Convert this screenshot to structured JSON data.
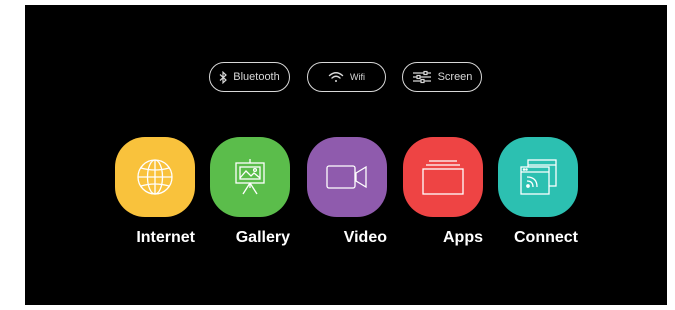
{
  "quick_settings": [
    {
      "label": "Bluetooth",
      "icon": "bluetooth-icon"
    },
    {
      "label": "Wifi",
      "icon": "wifi-icon"
    },
    {
      "label": "Screen",
      "icon": "sliders-icon"
    }
  ],
  "apps": [
    {
      "label": "Internet",
      "icon": "globe-icon",
      "color": "#f9c23c"
    },
    {
      "label": "Gallery",
      "icon": "presentation-board-icon",
      "color": "#5bbd4b"
    },
    {
      "label": "Video",
      "icon": "video-camera-icon",
      "color": "#8f5bad"
    },
    {
      "label": "Apps",
      "icon": "stacked-windows-icon",
      "color": "#ee4444"
    },
    {
      "label": "Connect",
      "icon": "screen-cast-icon",
      "color": "#2cc0b1"
    }
  ]
}
